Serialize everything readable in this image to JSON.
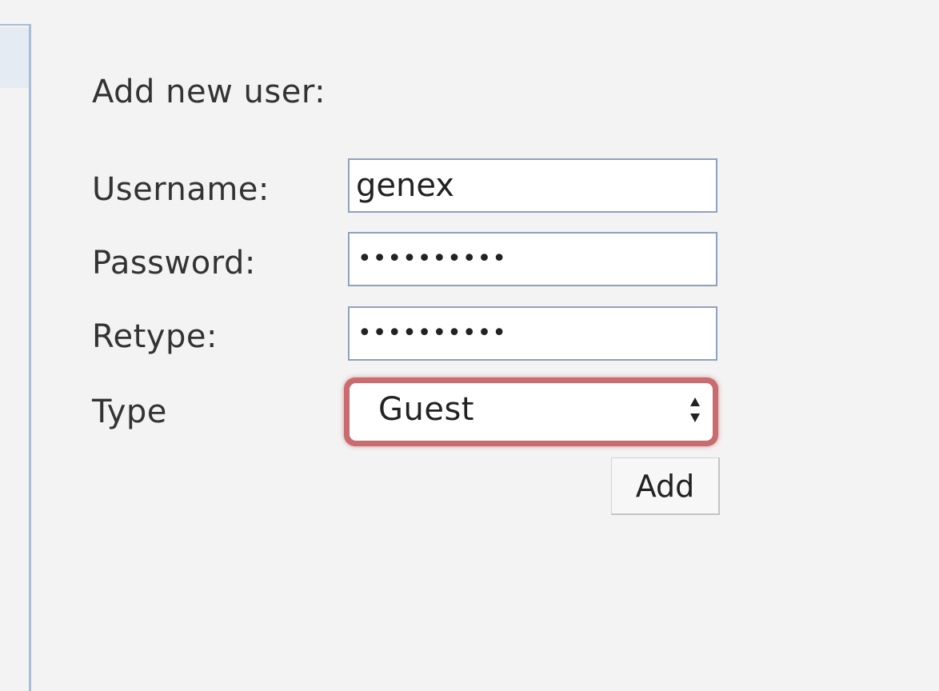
{
  "form": {
    "title": "Add new user:",
    "username": {
      "label": "Username:",
      "value": "genex"
    },
    "password": {
      "label": "Password:",
      "value": "••••••••••"
    },
    "retype": {
      "label": "Retype:",
      "value": "••••••••••"
    },
    "type": {
      "label": "Type",
      "selected": "Guest"
    },
    "add_label": "Add"
  },
  "colors": {
    "focus_ring": "#c96b6f",
    "field_border": "#8da2bd",
    "panel_border": "#a9bdd6",
    "background": "#f3f3f3"
  },
  "icons": {
    "select_arrows": "up-down-arrows-icon"
  }
}
